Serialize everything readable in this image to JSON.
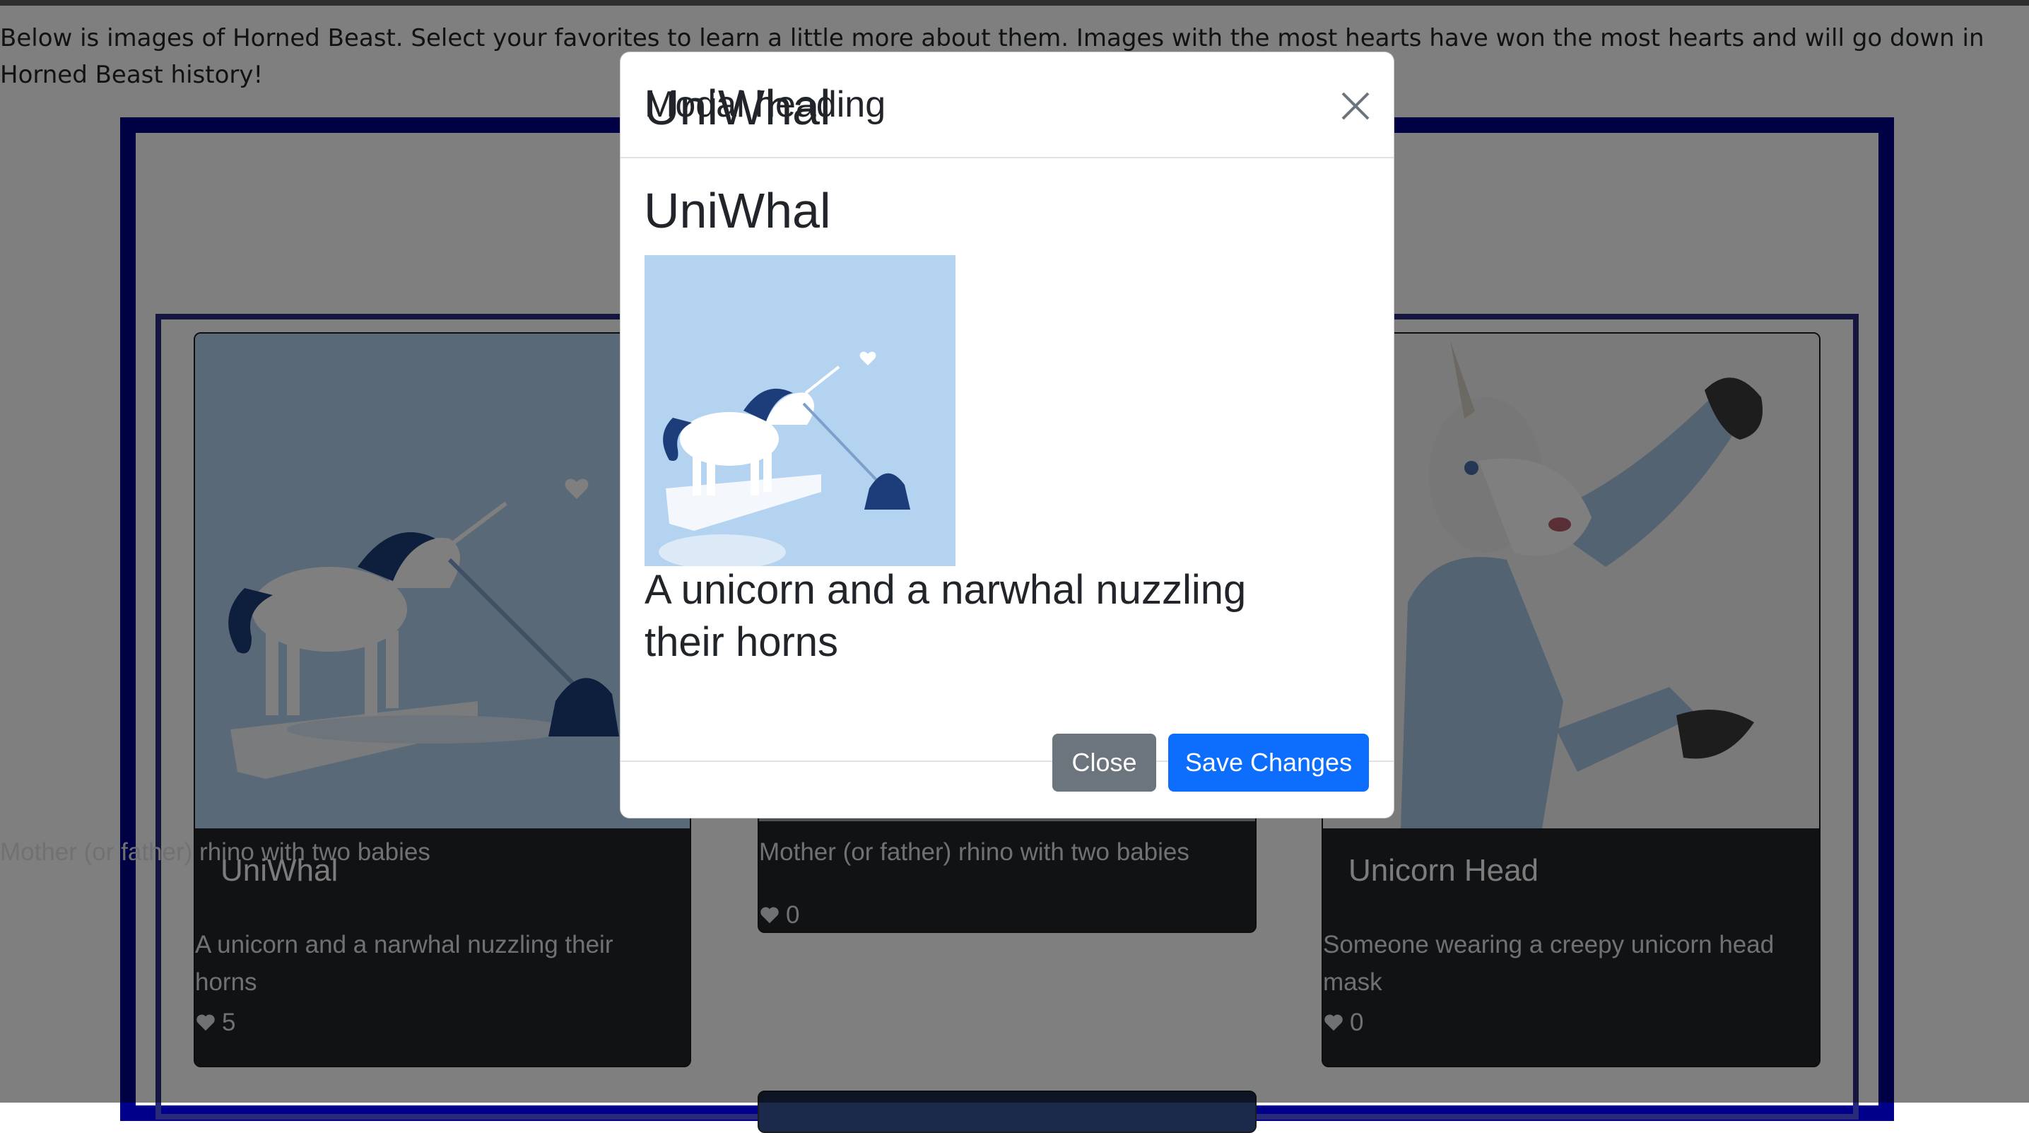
{
  "intro_text": "Below is images of Horned Beast. Select your favorites to learn a little more about them. Images with the most hearts have won the most hearts and will go down in Horned Beast history!",
  "cards": [
    {
      "title": "UniWhal",
      "description": "A unicorn and a narwhal nuzzling their horns",
      "hearts": "5"
    },
    {
      "title": "",
      "description": "Mother (or father) rhino with two babies",
      "hearts": "0"
    },
    {
      "title": "Unicorn Head",
      "description": "Someone wearing a creepy unicorn head mask",
      "hearts": "0"
    }
  ],
  "modal": {
    "heading": "Modal heading",
    "beast_title": "UniWhal",
    "beast_description": "A unicorn and a narwhal nuzzling their horns",
    "close_label": "Close",
    "save_label": "Save Changes"
  },
  "colors": {
    "primary": "#0d6efd",
    "secondary": "#6c757d",
    "card_bg": "#212529",
    "frame": "#00008b"
  }
}
